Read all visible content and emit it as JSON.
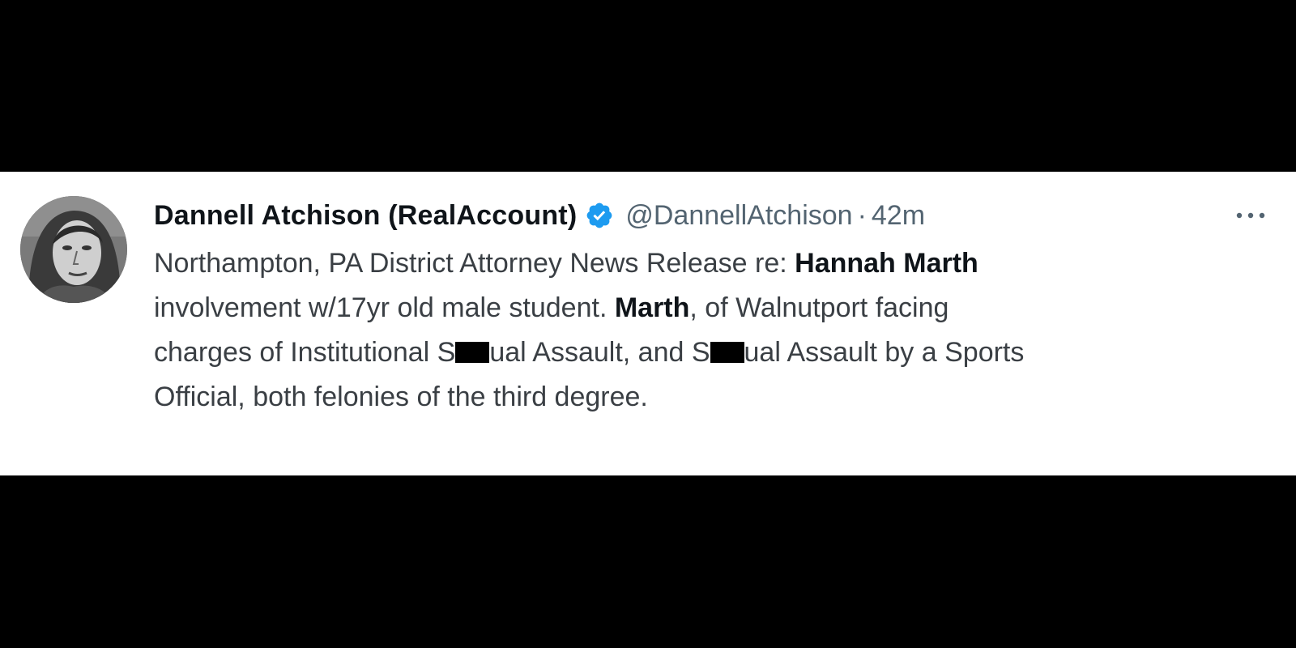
{
  "tweet": {
    "display_name": "Dannell Atchison (RealAccount)",
    "handle": "@DannellAtchison",
    "separator": "·",
    "time": "42m",
    "verified": true,
    "avatar_icon": "profile-photo",
    "more_icon": "more-horizontal-icon",
    "verified_color": "#1d9bf0",
    "body": {
      "line1_a": "Northampton, PA District Attorney News Release re: ",
      "line1_b": "Hannah Marth",
      "line2_a": "involvement w/17yr old male student. ",
      "line2_b": "Marth",
      "line2_c": ", of Walnutport facing",
      "line3_a": "charges of Institutional S",
      "line3_b": "ual Assault, and S",
      "line3_c": "ual Assault by a Sports",
      "line4": "Official, both felonies of the third degree."
    }
  }
}
